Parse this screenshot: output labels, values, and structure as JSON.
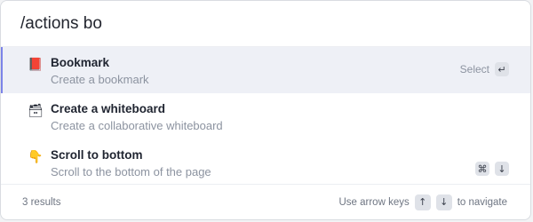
{
  "search": {
    "value": "/actions bo",
    "placeholder": ""
  },
  "results": [
    {
      "emoji": "📕",
      "title": "Bookmark",
      "description": "Create a bookmark",
      "select_label": "Select",
      "select_key": "↵"
    },
    {
      "emoji": "🗃",
      "title": "Create a whiteboard",
      "description": "Create a collaborative whiteboard"
    },
    {
      "emoji": "👇",
      "title": "Scroll to bottom",
      "description": "Scroll to the bottom of the page",
      "shortcut_keys": [
        "⌘",
        "↓"
      ]
    }
  ],
  "footer": {
    "count": "3 results",
    "hint_prefix": "Use arrow keys",
    "up_key": "↑",
    "down_key": "↓",
    "hint_suffix": "to navigate"
  },
  "colors": {
    "active_background": "#eef0f6",
    "active_indicator": "#7c83e8",
    "muted_text": "#8c93a0"
  }
}
